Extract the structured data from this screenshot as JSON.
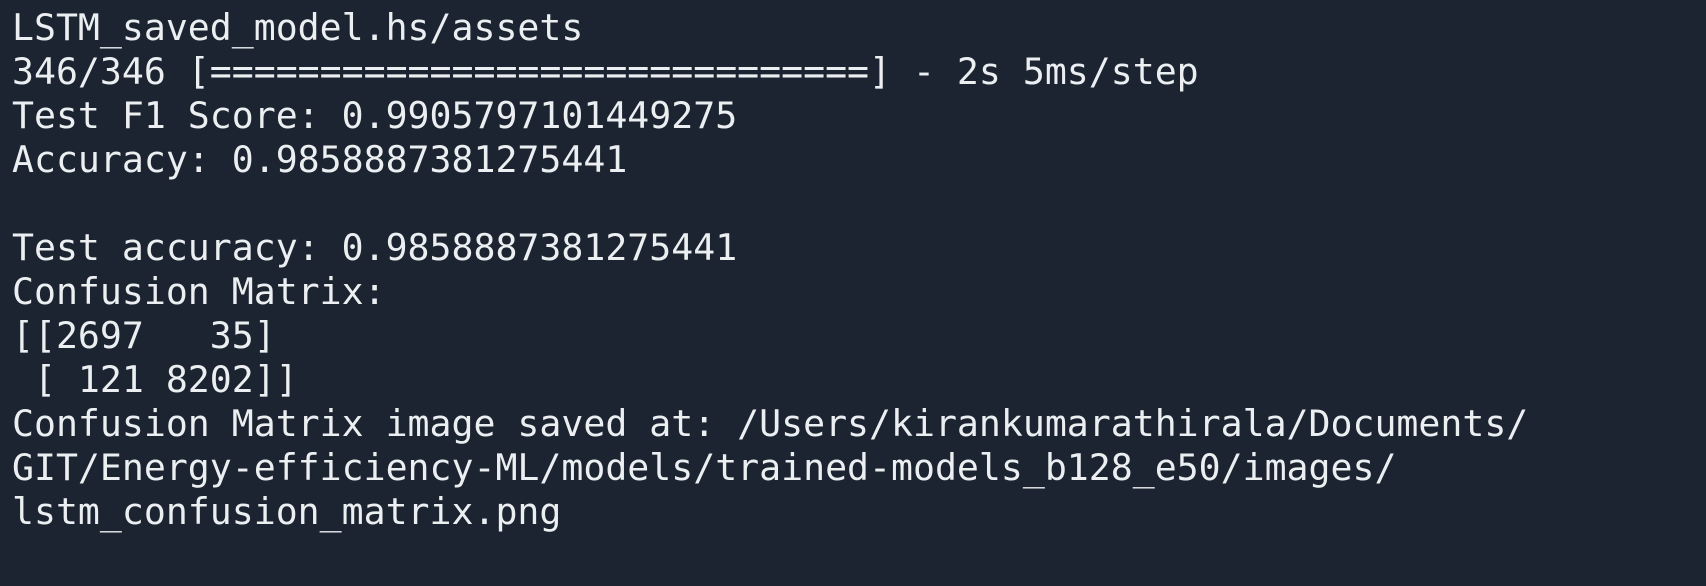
{
  "terminal": {
    "lines": [
      "LSTM_saved_model.hs/assets",
      "346/346 [==============================] - 2s 5ms/step",
      "Test F1 Score: 0.9905797101449275",
      "Accuracy: 0.9858887381275441",
      "",
      "Test accuracy: 0.9858887381275441",
      "Confusion Matrix:",
      "[[2697   35]",
      " [ 121 8202]]",
      "Confusion Matrix image saved at: /Users/kirankumarathirala/Documents/",
      "GIT/Energy-efficiency-ML/models/trained-models_b128_e50/images/",
      "lstm_confusion_matrix.png"
    ]
  }
}
